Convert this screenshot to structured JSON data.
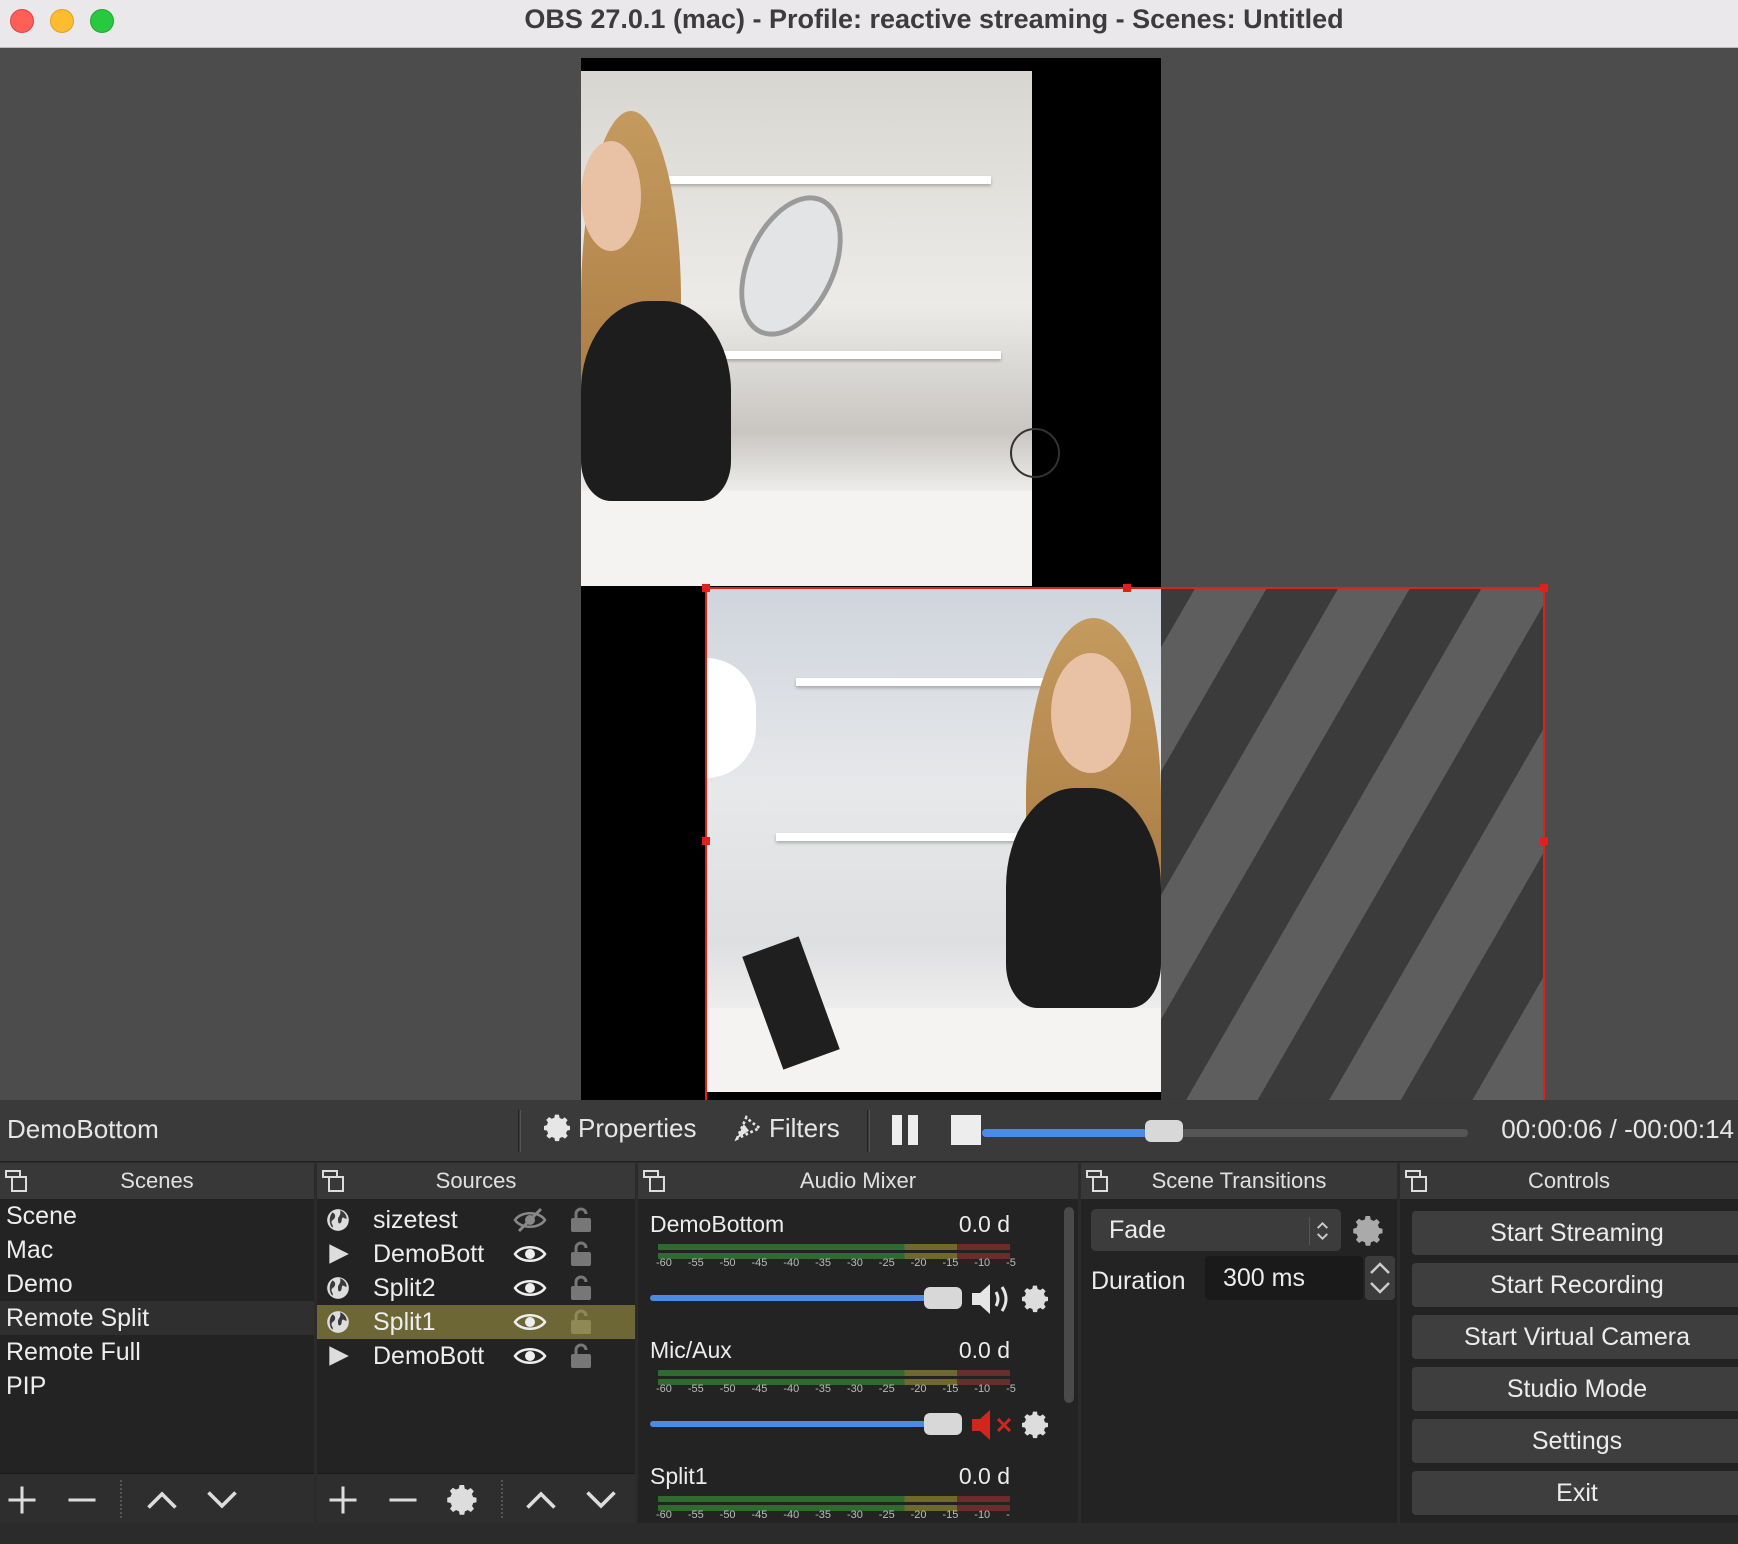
{
  "window": {
    "title": "OBS 27.0.1 (mac) - Profile: reactive streaming - Scenes: Untitled"
  },
  "source_toolbar": {
    "selected_source": "DemoBottom",
    "properties_label": "Properties",
    "filters_label": "Filters",
    "timecode": "00:00:06 / -00:00:14",
    "media_progress": 0.34
  },
  "scenes": {
    "title": "Scenes",
    "items": [
      "Scene",
      "Mac",
      "Demo",
      "Remote Split",
      "Remote Full",
      "PIP"
    ],
    "selected": "Remote Split"
  },
  "sources": {
    "title": "Sources",
    "items": [
      {
        "name": "sizetest",
        "type": "browser",
        "visible": false
      },
      {
        "name": "DemoBott",
        "type": "media",
        "visible": true
      },
      {
        "name": "Split2",
        "type": "browser",
        "visible": true
      },
      {
        "name": "Split1",
        "type": "browser",
        "visible": true
      },
      {
        "name": "DemoBott",
        "type": "media",
        "visible": true
      }
    ],
    "selected": "Split1"
  },
  "audio_mixer": {
    "title": "Audio Mixer",
    "ticks": [
      "-60",
      "-55",
      "-50",
      "-45",
      "-40",
      "-35",
      "-30",
      "-25",
      "-20",
      "-15",
      "-10",
      "-5"
    ],
    "channels": [
      {
        "name": "DemoBottom",
        "db": "0.0 d",
        "muted": false
      },
      {
        "name": "Mic/Aux",
        "db": "0.0 d",
        "muted": true
      },
      {
        "name": "Split1",
        "db": "0.0 d",
        "muted": false
      }
    ]
  },
  "scene_transitions": {
    "title": "Scene Transitions",
    "selected": "Fade",
    "duration_label": "Duration",
    "duration_value": "300 ms"
  },
  "controls": {
    "title": "Controls",
    "buttons": [
      "Start Streaming",
      "Start Recording",
      "Start Virtual Camera",
      "Studio Mode",
      "Settings",
      "Exit"
    ]
  },
  "colors": {
    "accent": "#4a8ce5",
    "selection_outline": "#e0201a",
    "selected_source_bg": "#6c6734",
    "muted": "#d0261d"
  }
}
